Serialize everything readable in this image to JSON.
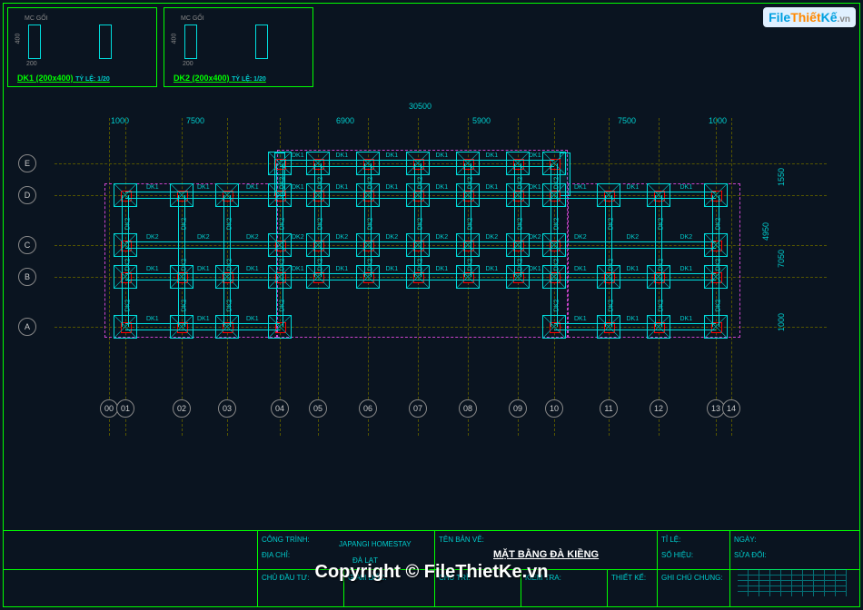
{
  "logo": {
    "file": "File",
    "thiet": "Thiết",
    "ke": "Kế",
    "vn": ".vn"
  },
  "details": {
    "box1": {
      "label": "DK1 (200x400)",
      "scale": "TỶ LỆ: 1/20",
      "section": "MC GỐI",
      "dim_w": "200",
      "dim_h": "400"
    },
    "box2": {
      "label": "DK2 (200x400)",
      "scale": "TỶ LỆ: 1/20",
      "section": "MC GỐI",
      "dim_w": "200",
      "dim_h": "400"
    }
  },
  "grid": {
    "rows": [
      "E",
      "D",
      "C",
      "B",
      "A"
    ],
    "cols": [
      "00",
      "01",
      "02",
      "03",
      "04",
      "05",
      "06",
      "07",
      "08",
      "09",
      "10",
      "11",
      "12",
      "13",
      "14"
    ],
    "row_y": [
      50,
      85,
      140,
      175,
      230
    ],
    "col_x": [
      60,
      78,
      140,
      190,
      248,
      290,
      345,
      400,
      455,
      510,
      550,
      610,
      665,
      728,
      745
    ]
  },
  "dims": {
    "top_total": "30500",
    "top_spans": [
      "1000",
      "7500",
      "6900",
      "5900",
      "7500",
      "1000"
    ],
    "right_spans": [
      "1550",
      "7050",
      "1000"
    ],
    "right_mid": "4950"
  },
  "beam_labels": {
    "dk1": "DK1",
    "dk2": "DK2"
  },
  "title_block": {
    "cong_trinh": "CÔNG TRÌNH:",
    "project": "JAPANGI HOMESTAY",
    "dia_chi": "ĐỊA CHỈ:",
    "location": "ĐÀ LẠT",
    "ten_ban_ve": "TÊN BẢN VẼ:",
    "drawing_title": "MẶT BẰNG ĐÀ KIỀNG",
    "chu_dau_tu": "CHỦ ĐẦU TƯ:",
    "giam_doc": "GIÁM ĐỐC:",
    "chu_tri": "CHỦ TRÌ:",
    "kiem_tra": "KIỂM TRA:",
    "thiet_ke": "THIẾT KẾ:",
    "ti_le": "TỈ LỆ:",
    "ngay": "NGÀY:",
    "so_hieu": "SỐ HIỆU:",
    "sua_doi": "SỬA ĐỔI:",
    "ghi_chu": "GHI CHÚ CHUNG:"
  },
  "watermark": "Copyright © FileThietKe.vn"
}
